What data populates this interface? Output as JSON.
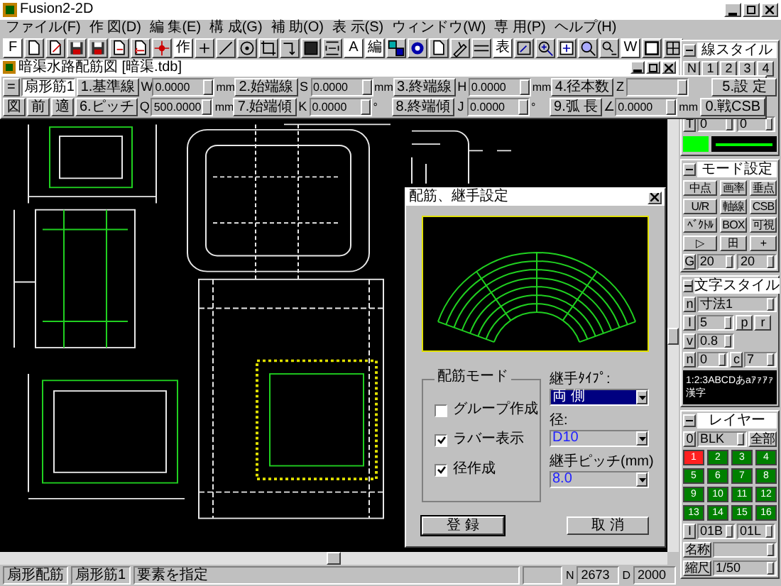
{
  "window": {
    "title": "Fusion2-2D"
  },
  "menu": [
    "ファイル(F)",
    "作 図(D)",
    "編 集(E)",
    "構 成(G)",
    "補 助(O)",
    "表 示(S)",
    "ウィンドウ(W)",
    "専 用(P)",
    "ヘルプ(H)"
  ],
  "toolbar": [
    {
      "kind": "text",
      "label": "F"
    },
    {
      "kind": "icon"
    },
    {
      "kind": "icon"
    },
    {
      "kind": "icon"
    },
    {
      "kind": "icon"
    },
    {
      "kind": "icon"
    },
    {
      "kind": "icon"
    },
    {
      "kind": "icon"
    },
    {
      "kind": "text",
      "label": "作"
    },
    {
      "kind": "icon"
    },
    {
      "kind": "icon"
    },
    {
      "kind": "icon"
    },
    {
      "kind": "icon"
    },
    {
      "kind": "icon"
    },
    {
      "kind": "icon"
    },
    {
      "kind": "icon"
    },
    {
      "kind": "text",
      "label": "A"
    },
    {
      "kind": "text",
      "label": "編"
    },
    {
      "kind": "icon"
    },
    {
      "kind": "icon"
    },
    {
      "kind": "icon"
    },
    {
      "kind": "icon"
    },
    {
      "kind": "icon"
    },
    {
      "kind": "text",
      "label": "表"
    },
    {
      "kind": "icon"
    },
    {
      "kind": "icon"
    },
    {
      "kind": "icon"
    },
    {
      "kind": "icon"
    },
    {
      "kind": "icon"
    },
    {
      "kind": "text",
      "label": "W"
    },
    {
      "kind": "icon"
    },
    {
      "kind": "icon"
    }
  ],
  "document": {
    "title": "暗渠水路配筋図 [暗渠.tdb]"
  },
  "param_rows": [
    [
      {
        "kind": "button",
        "label": "="
      },
      {
        "kind": "name",
        "value": "扇形筋1"
      },
      {
        "kind": "button",
        "label": "1.基準線"
      },
      {
        "kind": "letter",
        "label": "W"
      },
      {
        "kind": "field",
        "value": "0.0000"
      },
      {
        "kind": "unit",
        "label": "mm"
      },
      {
        "kind": "button",
        "label": "2.始端線"
      },
      {
        "kind": "letter",
        "label": "S"
      },
      {
        "kind": "field",
        "value": "0.0000"
      },
      {
        "kind": "unit",
        "label": "mm"
      },
      {
        "kind": "button",
        "label": "3.終端線"
      },
      {
        "kind": "letter",
        "label": "H"
      },
      {
        "kind": "field",
        "value": "0.0000"
      },
      {
        "kind": "unit",
        "label": "mm"
      },
      {
        "kind": "button",
        "label": "4.径本数"
      },
      {
        "kind": "letter",
        "label": "Z"
      },
      {
        "kind": "field"
      },
      {
        "kind": "unit"
      },
      {
        "kind": "wide",
        "label": "5.設 定"
      }
    ],
    [
      {
        "kind": "button",
        "label": "図"
      },
      {
        "kind": "button",
        "label": "前"
      },
      {
        "kind": "button",
        "label": "適"
      },
      {
        "kind": "button",
        "label": "6.ピッチ"
      },
      {
        "kind": "letter",
        "label": "Q"
      },
      {
        "kind": "field",
        "value": "500.0000"
      },
      {
        "kind": "unit",
        "label": "mm"
      },
      {
        "kind": "button",
        "label": "7.始端傾"
      },
      {
        "kind": "letter",
        "label": "K"
      },
      {
        "kind": "field",
        "value": "0.0000"
      },
      {
        "kind": "unit",
        "label": "°"
      },
      {
        "kind": "button",
        "label": "8.終端傾"
      },
      {
        "kind": "letter",
        "label": "J"
      },
      {
        "kind": "field",
        "value": "0.0000"
      },
      {
        "kind": "unit",
        "label": "°"
      },
      {
        "kind": "button",
        "label": "9.弧 長"
      },
      {
        "kind": "letter",
        "label": "∠"
      },
      {
        "kind": "field",
        "value": "0.0000"
      },
      {
        "kind": "unit",
        "label": "mm"
      },
      {
        "kind": "wide",
        "label": "0.戦CSB"
      }
    ]
  ],
  "dialog": {
    "title": "配筋、継手設定",
    "group_title": "配筋モード",
    "checkboxes": [
      {
        "label": "グループ作成",
        "checked": false
      },
      {
        "label": "ラバー表示",
        "checked": true
      },
      {
        "label": "径作成",
        "checked": true
      }
    ],
    "selects": [
      {
        "label": "継手ﾀｲﾌﾟ:",
        "value": "両 側",
        "selected": true
      },
      {
        "label": "径:",
        "value": "D10",
        "selected": false
      },
      {
        "label": "継手ピッチ(mm)",
        "value": "8.0",
        "selected": false
      }
    ],
    "buttons": [
      {
        "label": "登 録",
        "default": true
      },
      {
        "label": "取 消",
        "default": false
      }
    ]
  },
  "status_bar": {
    "mode": "扇形配筋",
    "element": "扇形筋1",
    "prompt": "要素を指定",
    "n_label": "N",
    "n": "2673",
    "d_label": "D",
    "d": "2000"
  },
  "line_style": {
    "title": "線スタイル",
    "buttons": [
      "N",
      "1",
      "2",
      "3",
      "4"
    ],
    "t_label": "T",
    "values": [
      "0",
      "0"
    ],
    "color": "#00ff00"
  },
  "mode_settings": {
    "title": "モード設定",
    "buttons": [
      "中点",
      "画率",
      "垂点",
      "U/R",
      "軸線",
      "CSB",
      "ﾍﾞｸﾄﾙ",
      "BOX",
      "可視",
      "▷",
      "田",
      "+"
    ],
    "g_label": "G",
    "values": [
      "20",
      "20"
    ]
  },
  "text_style": {
    "title": "文字スタイル",
    "n_label": "n",
    "style": "寸法1",
    "i_label": "I",
    "size": "5",
    "p_label": "p",
    "r_label": "r",
    "v_label": "v",
    "ratio": "0.8",
    "n2_label": "n",
    "angle": "0",
    "c_label": "c",
    "color_no": "7",
    "preview": "1:2:3ABCDあaｱｧｱｧ漢字"
  },
  "layer": {
    "title": "レイヤー",
    "zero": "0",
    "blk": "BLK",
    "all": "全部",
    "layers": [
      {
        "label": "1",
        "selected": true
      },
      {
        "label": "2",
        "selected": false
      },
      {
        "label": "3",
        "selected": false
      },
      {
        "label": "4",
        "selected": false
      },
      {
        "label": "5",
        "selected": false
      },
      {
        "label": "6",
        "selected": false
      },
      {
        "label": "7",
        "selected": false
      },
      {
        "label": "8",
        "selected": false
      },
      {
        "label": "9",
        "selected": false
      },
      {
        "label": "10",
        "selected": false
      },
      {
        "label": "11",
        "selected": false
      },
      {
        "label": "12",
        "selected": false
      },
      {
        "label": "13",
        "selected": false
      },
      {
        "label": "14",
        "selected": false
      },
      {
        "label": "15",
        "selected": false
      },
      {
        "label": "16",
        "selected": false
      }
    ],
    "i_label": "I",
    "b": "01B",
    "l": "01L",
    "name_label": "名称",
    "scale_label": "縮尺",
    "scale": "1/50"
  }
}
